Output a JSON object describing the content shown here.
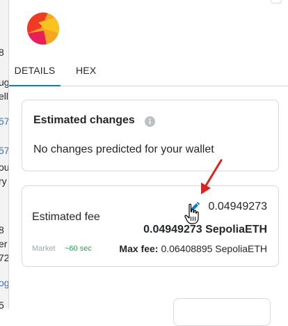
{
  "background_fragments": [
    {
      "text": "8",
      "color": "#24272a"
    },
    {
      "text": "ug",
      "color": "#24272a"
    },
    {
      "text": "ell",
      "color": "#24272a"
    },
    {
      "text": "57",
      "color": "#3e6eb3"
    },
    {
      "text": "57",
      "color": "#3e6eb3"
    },
    {
      "text": "ou",
      "color": "#24272a"
    },
    {
      "text": "ry",
      "color": "#24272a"
    },
    {
      "text": "8",
      "color": "#24272a"
    },
    {
      "text": "er",
      "color": "#24272a"
    },
    {
      "text": "72",
      "color": "#24272a"
    },
    {
      "text": "og",
      "color": "#3e6eb3"
    },
    {
      "text": "5",
      "color": "#24272a"
    }
  ],
  "tabs": {
    "details": "DETAILS",
    "hex": "HEX"
  },
  "estimated_changes": {
    "title": "Estimated changes",
    "message": "No changes predicted for your wallet"
  },
  "estimated_fee": {
    "label": "Estimated fee",
    "amount": "0.04949273",
    "total": "0.04949273 SepoliaETH",
    "market_label": "Market",
    "market_time": "~60 sec",
    "max_fee_label": "Max fee:",
    "max_fee_value": "0.06408895 SepoliaETH"
  },
  "icons": {
    "info": "info-icon",
    "edit": "pencil-icon",
    "annotation": "red-arrow",
    "cursor": "hand-cursor-icon"
  },
  "colors": {
    "accent_blue": "#037dd6",
    "arrow_red": "#e0201b",
    "market_green": "#28a745",
    "muted_gray": "#9fa6ae"
  }
}
